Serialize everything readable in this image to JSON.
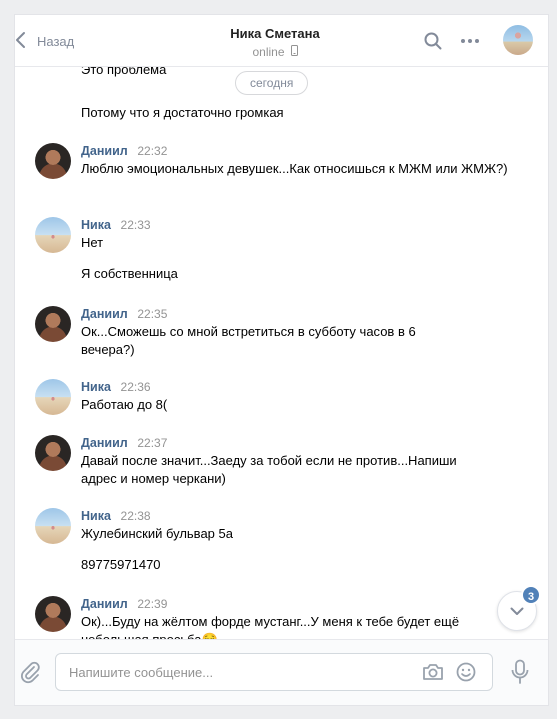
{
  "header": {
    "back_label": "Назад",
    "contact_name": "Ника Сметана",
    "status": "online"
  },
  "feed": {
    "partial_top_text": "Это проблема",
    "date_separator": "сегодня",
    "tail_text": "Потому что я достаточно громкая"
  },
  "messages": [
    {
      "author": "Даниил",
      "time": "22:32",
      "lines": [
        "Люблю эмоциональных девушек...Как относишься к МЖМ или ЖМЖ?)"
      ],
      "avatar": "daniil"
    },
    {
      "author": "Ника",
      "time": "22:33",
      "lines": [
        "Нет",
        "Я собственница"
      ],
      "avatar": "nika"
    },
    {
      "author": "Даниил",
      "time": "22:35",
      "lines": [
        "Ок...Сможешь со мной встретиться в субботу часов в 6 вечера?)"
      ],
      "avatar": "daniil"
    },
    {
      "author": "Ника",
      "time": "22:36",
      "lines": [
        "Работаю до 8("
      ],
      "avatar": "nika"
    },
    {
      "author": "Даниил",
      "time": "22:37",
      "lines": [
        "Давай после значит...Заеду за тобой если не против...Напиши адрес и номер черкани)"
      ],
      "avatar": "daniil"
    },
    {
      "author": "Ника",
      "time": "22:38",
      "lines": [
        "Жулебинский бульвар 5а",
        "89775971470"
      ],
      "avatar": "nika"
    },
    {
      "author": "Даниил",
      "time": "22:39",
      "lines": [
        "Ок)...Буду на жёлтом форде мустанг...У меня к тебе будет ещё небольшая просьба😌"
      ],
      "avatar": "daniil"
    }
  ],
  "unread_badge": "3",
  "composer": {
    "placeholder": "Напишите сообщение..."
  },
  "icons": {
    "back": "chevron-left-icon",
    "search": "search-icon",
    "more": "more-dots-icon",
    "phone": "phone-icon",
    "attach": "paperclip-icon",
    "camera": "camera-icon",
    "emoji": "smile-icon",
    "mic": "microphone-icon",
    "scroll_down": "chevron-down-icon"
  },
  "colors": {
    "accent": "#5181b8",
    "author_name": "#42648b",
    "muted": "#939393"
  }
}
